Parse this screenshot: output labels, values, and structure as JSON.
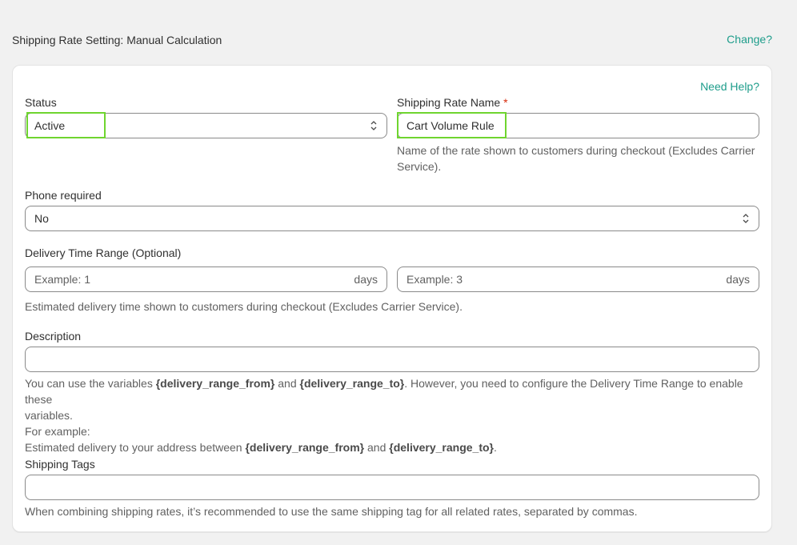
{
  "header": {
    "title": "Shipping Rate Setting: Manual Calculation",
    "change_label": "Change?"
  },
  "card": {
    "help_label": "Need Help?"
  },
  "status": {
    "label": "Status",
    "value": "Active"
  },
  "rate_name": {
    "label": "Shipping Rate Name",
    "required_mark": "*",
    "value": "Cart Volume Rule",
    "help": "Name of the rate shown to customers during checkout (Excludes Carrier Service)."
  },
  "phone": {
    "label": "Phone required",
    "value": "No"
  },
  "delivery": {
    "label": "Delivery Time Range (Optional)",
    "from_placeholder": "Example: 1",
    "to_placeholder": "Example: 3",
    "unit": "days",
    "help": "Estimated delivery time shown to customers during checkout (Excludes Carrier Service)."
  },
  "description": {
    "label": "Description",
    "value": "",
    "help_part1": "You can use the variables ",
    "var_from": "{delivery_range_from}",
    "help_and": " and ",
    "var_to": "{delivery_range_to}",
    "help_part2": ". However, you need to configure the Delivery Time Range to enable these",
    "help_line2": "variables.",
    "example_label": "For example:",
    "example_part1": "Estimated delivery to your address between ",
    "example_and": " and ",
    "example_end": "."
  },
  "tags": {
    "label": "Shipping Tags",
    "value": "",
    "help": "When combining shipping rates, it’s recommended to use the same shipping tag for all related rates, separated by commas."
  },
  "colors": {
    "accent": "#1e9d8b",
    "highlight": "#6fd52f",
    "required": "#d72c0d"
  }
}
